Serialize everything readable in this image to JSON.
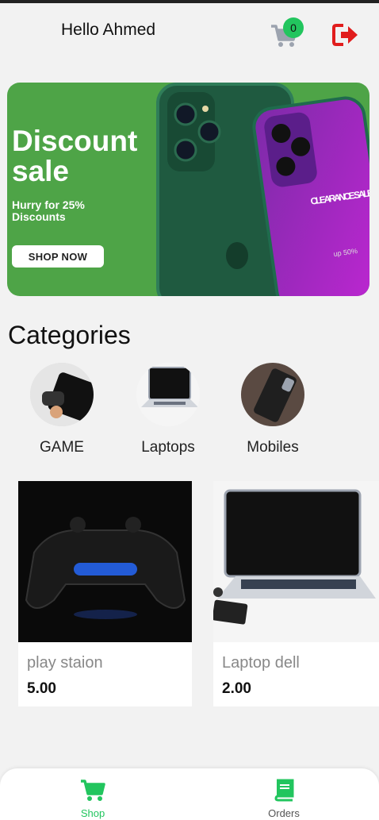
{
  "header": {
    "greeting": "Hello Ahmed",
    "cart_count": "0"
  },
  "banner": {
    "title": "Discount sale",
    "subtitle": "Hurry for 25% Discounts",
    "button": "SHOP NOW",
    "phone_text": "CLEARANCE SALE",
    "phone_text2": "up 50%"
  },
  "categories": {
    "title": "Categories",
    "items": [
      {
        "label": "GAME",
        "icon": "game-icon"
      },
      {
        "label": "Laptops",
        "icon": "laptop-icon"
      },
      {
        "label": "Mobiles",
        "icon": "mobile-icon"
      }
    ]
  },
  "products": [
    {
      "name": "play staion",
      "price": "5.00"
    },
    {
      "name": "Laptop dell",
      "price": "2.00"
    }
  ],
  "nav": {
    "items": [
      {
        "label": "Shop",
        "icon": "cart-icon",
        "active": true
      },
      {
        "label": "Orders",
        "icon": "book-icon",
        "active": false
      }
    ]
  },
  "colors": {
    "accent": "#22c55e",
    "banner": "#4ea447",
    "logout": "#e11d1d"
  }
}
